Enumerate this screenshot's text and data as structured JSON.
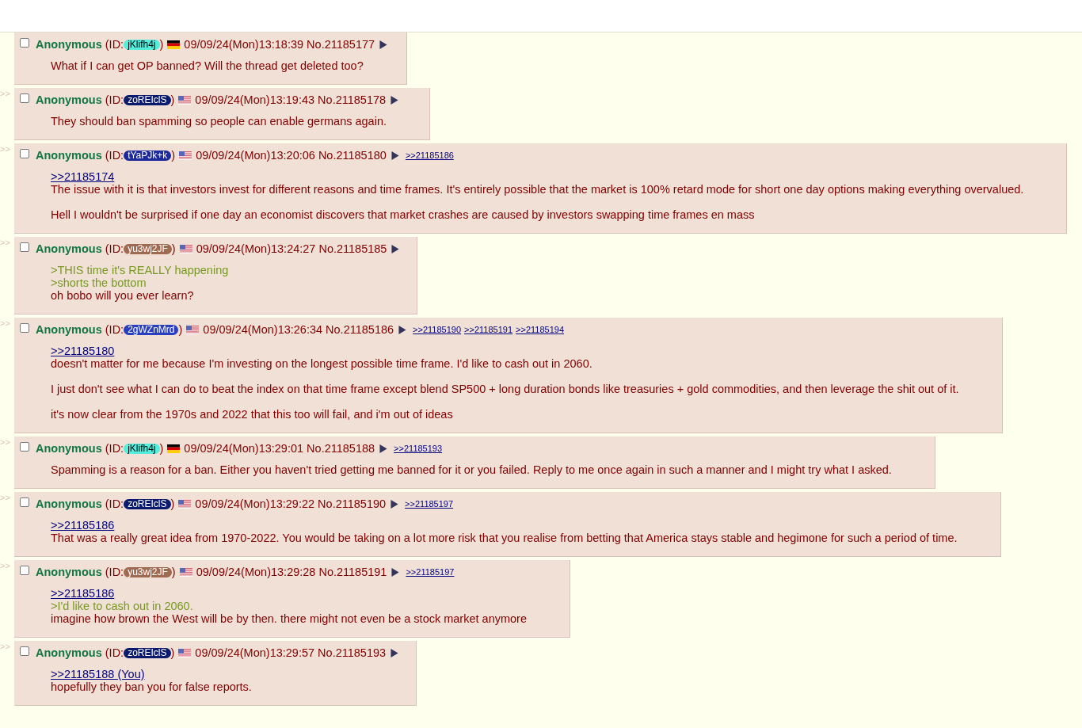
{
  "posts": [
    {
      "name": "Anonymous",
      "id_label": "(ID:",
      "id": {
        "text": "jKlifh4j",
        "color": "#55eedd"
      },
      "id_close": ")",
      "flag": {
        "kind": "de"
      },
      "date": "09/09/24(Mon)13:18:39",
      "no": "No.21185177",
      "checked": false,
      "body": [
        [
          {
            "kind": "text",
            "text": "What if I can get OP banned? Will the thread get deleted too?"
          }
        ]
      ]
    },
    {
      "side": ">>",
      "name": "Anonymous",
      "id_label": "(ID:",
      "id": {
        "text": "zoREIclS",
        "color": "#0a1a6e"
      },
      "id_close": ")",
      "flag": {
        "kind": "us"
      },
      "date": "09/09/24(Mon)13:19:43",
      "no": "No.21185178",
      "checked": false,
      "body": [
        [
          {
            "kind": "text",
            "text": "They should ban spamming so people can enable germans again."
          }
        ]
      ]
    },
    {
      "side": ">>",
      "name": "Anonymous",
      "id_label": "(ID:",
      "id": {
        "text": "tYaPJk+k",
        "color": "#1c2a9e"
      },
      "id_close": ")",
      "flag": {
        "kind": "us"
      },
      "date": "09/09/24(Mon)13:20:06",
      "no": "No.21185180",
      "checked": false,
      "replies": [
        ">>21185186"
      ],
      "body": [
        [
          {
            "kind": "link",
            "text": ">>21185174"
          },
          {
            "kind": "text",
            "text": "The issue with it is that investors invest for different reasons and time frames. It's entirely possible that the market is 100% retard mode for short one day options making everything overvalued."
          }
        ],
        [
          {
            "kind": "text",
            "text": "Hell I wouldn't be surprised if one day an economist discovers that market crashes are caused by investors swapping time frames en mass"
          }
        ]
      ]
    },
    {
      "side": ">>",
      "name": "Anonymous",
      "id_label": "(ID:",
      "id": {
        "text": "yu3wj2JF",
        "color": "#a06a50"
      },
      "id_close": ")",
      "flag": {
        "kind": "us"
      },
      "date": "09/09/24(Mon)13:24:27",
      "no": "No.21185185",
      "checked": false,
      "body": [
        [
          {
            "kind": "green",
            "text": ">THIS time it's REALLY happening"
          },
          {
            "kind": "green",
            "text": ">shorts the bottom"
          },
          {
            "kind": "text",
            "text": "oh bobo will you ever learn?"
          }
        ]
      ]
    },
    {
      "side": ">>",
      "name": "Anonymous",
      "id_label": "(ID:",
      "id": {
        "text": "2gWZnMrd",
        "color": "#2a3fc0"
      },
      "id_close": ")",
      "flag": {
        "kind": "us"
      },
      "date": "09/09/24(Mon)13:26:34",
      "no": "No.21185186",
      "checked": false,
      "replies": [
        ">>21185190",
        ">>21185191",
        ">>21185194"
      ],
      "body": [
        [
          {
            "kind": "link",
            "text": ">>21185180"
          },
          {
            "kind": "text",
            "text": "doesn't matter for me because I'm investing on the longest possible time frame. I'd like to cash out in 2060."
          }
        ],
        [
          {
            "kind": "text",
            "text": "I just don't see what I can do to beat the index on that time frame except blend SP500 + long duration bonds like treasuries + gold commodities, and then leverage the shit out of it."
          }
        ],
        [
          {
            "kind": "text",
            "text": "it's now clear from the 1970s and 2022 that this too will fail, and i'm out of ideas"
          }
        ]
      ]
    },
    {
      "side": ">>",
      "name": "Anonymous",
      "id_label": "(ID:",
      "id": {
        "text": "jKlifh4j",
        "color": "#55eedd"
      },
      "id_close": ")",
      "flag": {
        "kind": "de"
      },
      "date": "09/09/24(Mon)13:29:01",
      "no": "No.21185188",
      "checked": false,
      "replies": [
        ">>21185193"
      ],
      "body": [
        [
          {
            "kind": "text",
            "text": "Spamming is a reason for a ban. Either you haven't tried getting me banned for it or you failed. Reply to me once again in such a manner and I might try what I asked."
          }
        ]
      ]
    },
    {
      "side": ">>",
      "name": "Anonymous",
      "id_label": "(ID:",
      "id": {
        "text": "zoREIclS",
        "color": "#0a1a6e"
      },
      "id_close": ")",
      "flag": {
        "kind": "us"
      },
      "date": "09/09/24(Mon)13:29:22",
      "no": "No.21185190",
      "checked": false,
      "replies": [
        ">>21185197"
      ],
      "body": [
        [
          {
            "kind": "link",
            "text": ">>21185186"
          },
          {
            "kind": "text",
            "text": "That was a really great idea from 1970-2022. You would be taking on a lot more risk that you realise from betting that America stays stable and hegimone for such a period of time."
          }
        ]
      ]
    },
    {
      "side": ">>",
      "name": "Anonymous",
      "id_label": "(ID:",
      "id": {
        "text": "yu3wj2JF",
        "color": "#a06a50"
      },
      "id_close": ")",
      "flag": {
        "kind": "us"
      },
      "date": "09/09/24(Mon)13:29:28",
      "no": "No.21185191",
      "checked": false,
      "replies": [
        ">>21185197"
      ],
      "body": [
        [
          {
            "kind": "link",
            "text": ">>21185186"
          },
          {
            "kind": "green",
            "text": ">I'd like to cash out in 2060."
          },
          {
            "kind": "text",
            "text": "imagine how brown the West will be by then. there might not even be a stock market anymore"
          }
        ]
      ]
    },
    {
      "side": ">>",
      "name": "Anonymous",
      "id_label": "(ID:",
      "id": {
        "text": "zoREIclS",
        "color": "#0a1a6e"
      },
      "id_close": ")",
      "flag": {
        "kind": "us"
      },
      "date": "09/09/24(Mon)13:29:57",
      "no": "No.21185193",
      "checked": false,
      "body": [
        [
          {
            "kind": "link",
            "text": ">>21185188 (You)"
          },
          {
            "kind": "text",
            "text": "hopefully they ban you for false reports."
          }
        ]
      ]
    }
  ]
}
